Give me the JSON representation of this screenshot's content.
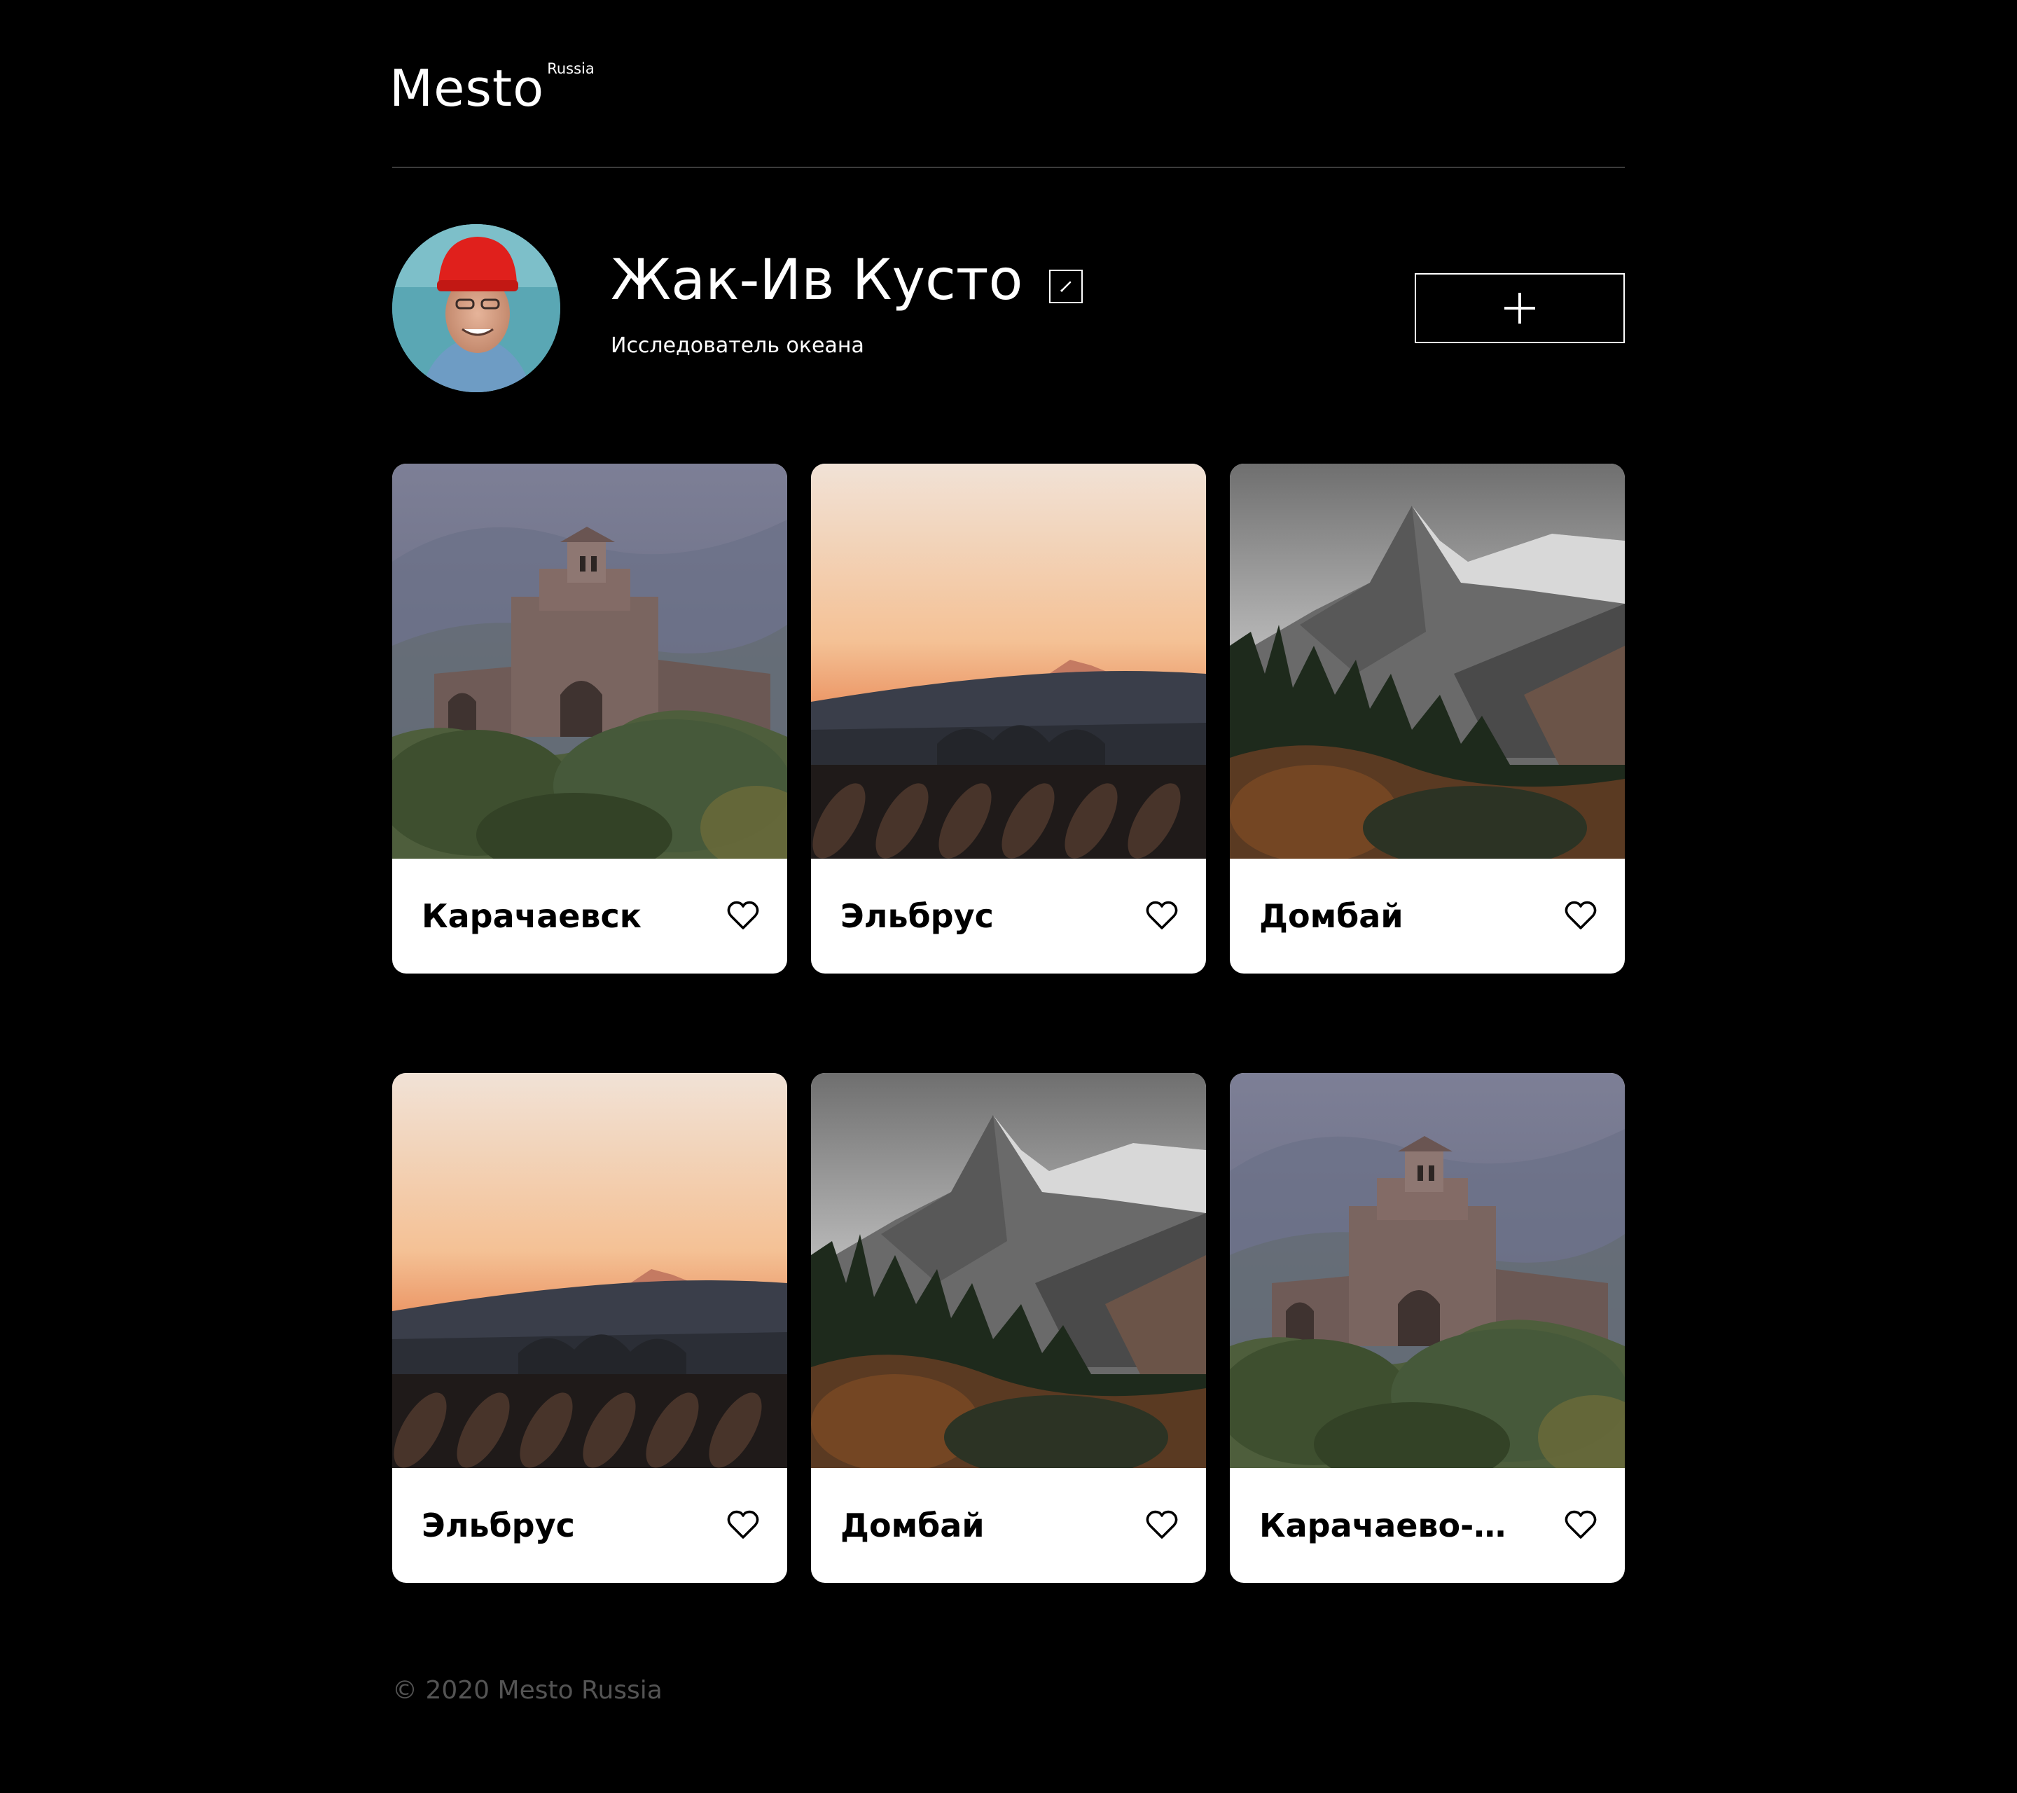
{
  "logo": {
    "main": "Mesto",
    "sup": "Russia"
  },
  "profile": {
    "name": "Жак-Ив Кусто",
    "about": "Исследователь океана"
  },
  "icons": {
    "edit": "edit-pencil-icon",
    "add": "plus-icon",
    "like": "heart-outline-icon"
  },
  "cards": [
    {
      "title": "Карачаевск",
      "scene": "church"
    },
    {
      "title": "Эльбрус",
      "scene": "sunset"
    },
    {
      "title": "Домбай",
      "scene": "mountain"
    },
    {
      "title": "Эльбрус",
      "scene": "sunset"
    },
    {
      "title": "Домбай",
      "scene": "mountain"
    },
    {
      "title": "Карачаево-Черкесия",
      "scene": "church"
    }
  ],
  "footer": {
    "copyright": "© 2020 Mesto Russia"
  },
  "colors": {
    "background": "#000000",
    "card": "#FFFFFF",
    "footer_text": "#545454"
  }
}
